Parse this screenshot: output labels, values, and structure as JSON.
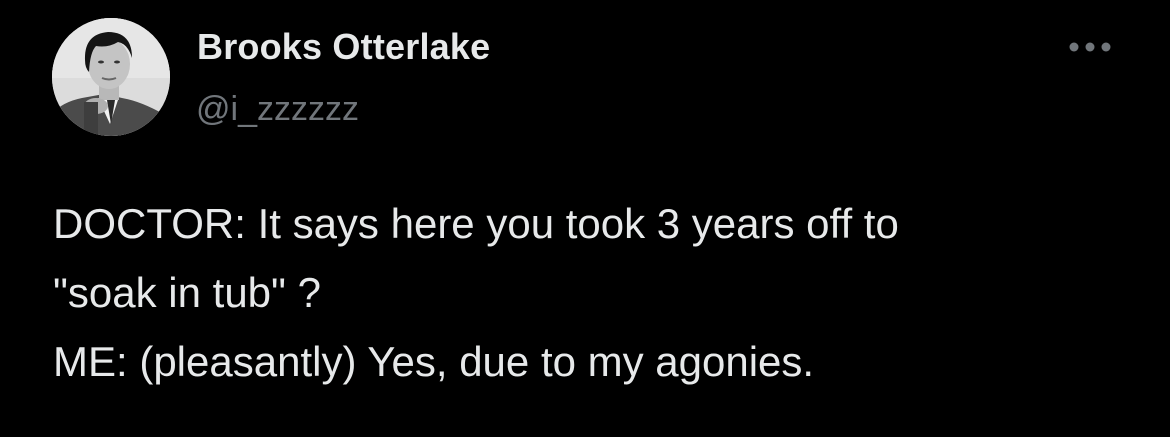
{
  "tweet": {
    "author": {
      "display_name": "Brooks Otterlake",
      "handle": "@i_zzzzzz",
      "avatar_icon": "profile-photo"
    },
    "more_icon": "more-horizontal-icon",
    "text_lines": [
      "DOCTOR: It says here you took 3 years off to",
      "\"soak in tub\" ?",
      "ME: (pleasantly) Yes, due to my agonies."
    ]
  },
  "colors": {
    "background": "#000000",
    "primary_text": "#e7e9ea",
    "secondary_text": "#71767b"
  }
}
